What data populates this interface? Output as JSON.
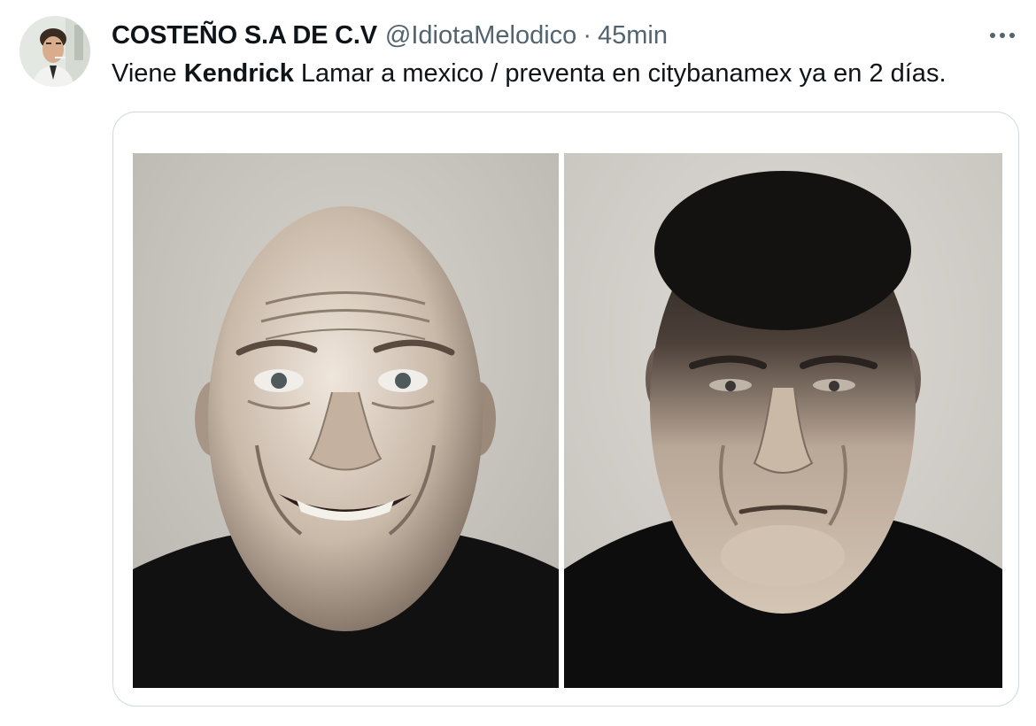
{
  "tweet": {
    "display_name": "COSTEÑO S.A DE C.V",
    "handle": "@IdiotaMelodico",
    "separator": "·",
    "time": "45min",
    "text_before": "Viene ",
    "text_bold": "Kendrick",
    "text_after": " Lamar a mexico / preventa en citybanamex ya en 2 días."
  },
  "icons": {
    "more": "more-horizontal-icon"
  },
  "colors": {
    "text_primary": "#0f1419",
    "text_secondary": "#536471",
    "card_border": "#cfd9de"
  }
}
